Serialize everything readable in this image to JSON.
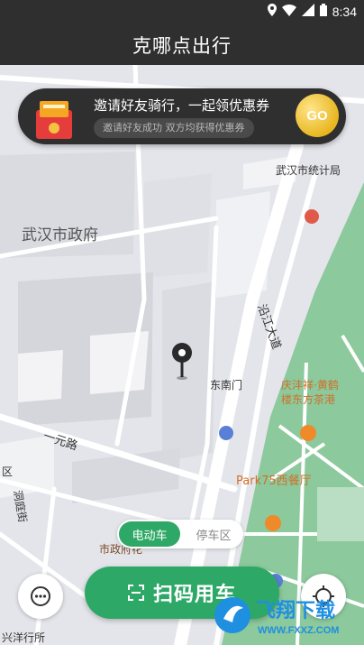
{
  "status_bar": {
    "time": "8:34",
    "icons": [
      "location-icon",
      "wifi-icon",
      "signal-icon",
      "battery-icon"
    ]
  },
  "header": {
    "title": "克哪点出行"
  },
  "banner": {
    "title": "邀请好友骑行，一起领优惠券",
    "subtitle": "邀请好友成功 双方均获得优惠券",
    "coin_text": "GO"
  },
  "map": {
    "labels": {
      "government": "武汉市政府",
      "statistics": "武汉市统计局",
      "road_yanjiang": "沿江大道",
      "dongnanmen": "东南门",
      "yiyuan_road": "一元路",
      "qingxiang": "庆沣祥·黄鹤",
      "qingxiang2": "楼东方茶港",
      "park75": "Park75西餐厅",
      "municipal": "市政府花",
      "xingyang": "兴洋行所",
      "road_left": "洞庭街",
      "road_left2": "区"
    }
  },
  "toggle": {
    "active": "电动车",
    "inactive": "停车区"
  },
  "scan_button": {
    "label": "扫码用车"
  },
  "watermark": {
    "brand": "飞翔下载",
    "url": "WWW.FXXZ.COM"
  },
  "colors": {
    "accent": "#2ea866",
    "bar": "#2f2f2f",
    "park": "#8cc99c",
    "coin": "#e8b620"
  }
}
